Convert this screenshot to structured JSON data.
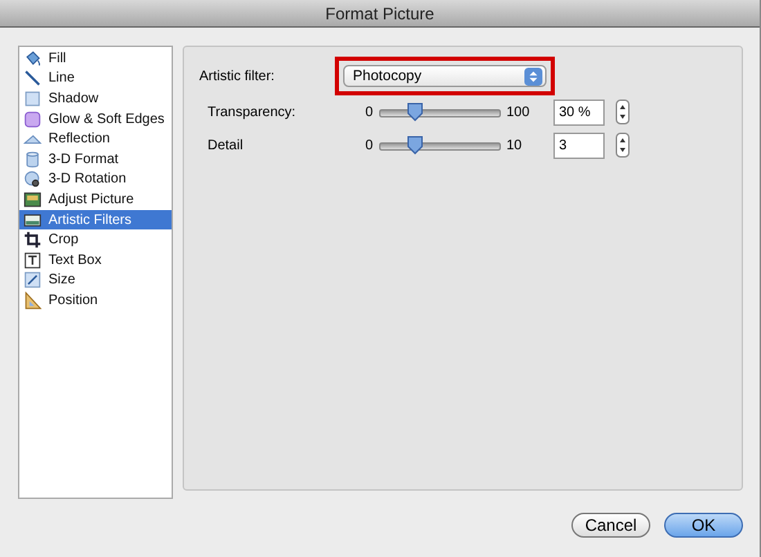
{
  "window": {
    "title": "Format Picture"
  },
  "sidebar": {
    "items": [
      {
        "label": "Fill",
        "selected": false
      },
      {
        "label": "Line",
        "selected": false
      },
      {
        "label": "Shadow",
        "selected": false
      },
      {
        "label": "Glow & Soft Edges",
        "selected": false
      },
      {
        "label": "Reflection",
        "selected": false
      },
      {
        "label": "3-D Format",
        "selected": false
      },
      {
        "label": "3-D Rotation",
        "selected": false
      },
      {
        "label": "Adjust Picture",
        "selected": false
      },
      {
        "label": "Artistic Filters",
        "selected": true
      },
      {
        "label": "Crop",
        "selected": false
      },
      {
        "label": "Text Box",
        "selected": false
      },
      {
        "label": "Size",
        "selected": false
      },
      {
        "label": "Position",
        "selected": false
      }
    ]
  },
  "panel": {
    "filter": {
      "label": "Artistic filter:",
      "value": "Photocopy",
      "highlighted": true
    },
    "sliders": [
      {
        "label": "Transparency:",
        "min": "0",
        "max": "100",
        "level": 0.3,
        "value": "30 %"
      },
      {
        "label": "Detail",
        "min": "0",
        "max": "10",
        "level": 0.3,
        "value": "3"
      }
    ]
  },
  "buttons": [
    {
      "label": "Cancel",
      "default": false
    },
    {
      "label": "OK",
      "default": true
    }
  ]
}
